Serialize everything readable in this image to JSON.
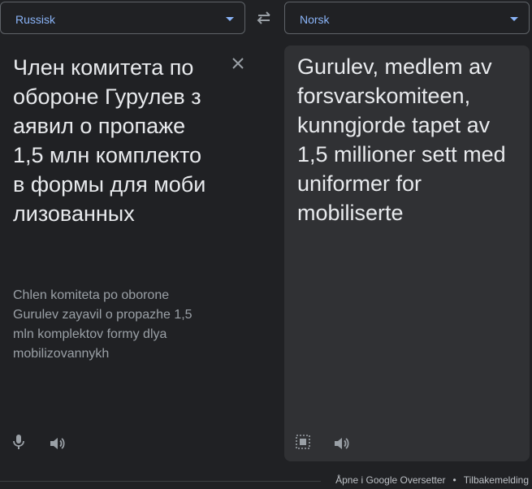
{
  "source_language": {
    "label": "Russisk"
  },
  "target_language": {
    "label": "Norsk"
  },
  "swap": {
    "icon": "swap-languages-icon"
  },
  "source": {
    "text": "Член комитета по обороне Гурулев заявил о пропаже 1,5 млн комплектов формы для мобилизованных",
    "transliteration": "Chlen komiteta po oborone Gurulev zayavil o propazhe 1,5 mln komplektov formy dlya mobilizovannykh",
    "clear_icon": "close-icon",
    "mic_icon": "microphone-icon",
    "listen_icon": "speaker-icon"
  },
  "target": {
    "text": "Gurulev, medlem av forsvarskomiteen, kunngjorde tapet av 1,5 millioner sett med uniformer for mobiliserte",
    "select_icon": "select-text-icon",
    "listen_icon": "speaker-icon"
  },
  "footer": {
    "open_link": "Åpne i Google Oversetter",
    "separator": "•",
    "feedback_link": "Tilbakemelding"
  },
  "colors": {
    "background": "#202124",
    "panel": "#303134",
    "accent": "#8ab4f8",
    "text": "#e8eaed",
    "secondary_text": "#9aa0a6"
  }
}
